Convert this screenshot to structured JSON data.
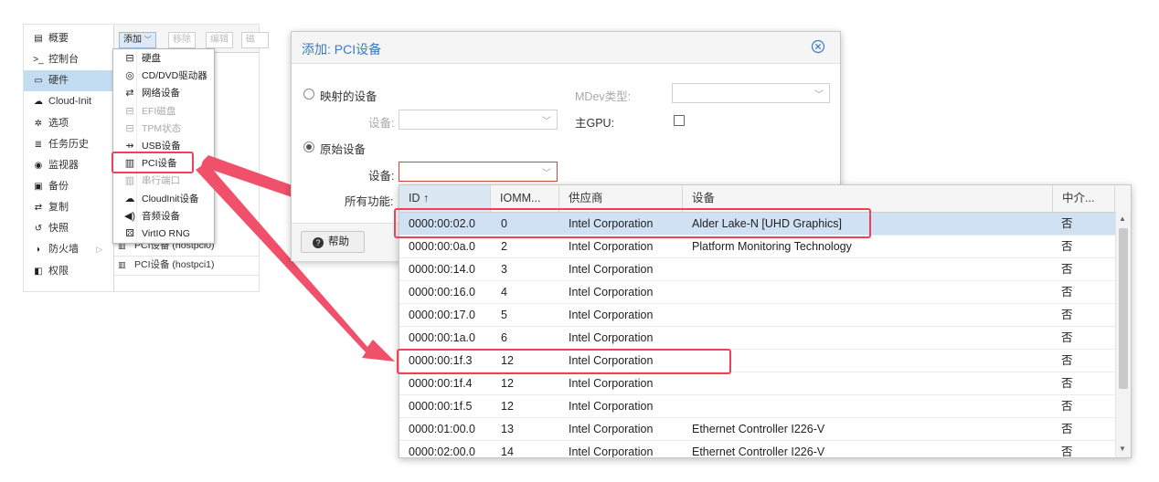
{
  "nav": {
    "items": [
      {
        "icon": "book-icon",
        "glyph": "▤",
        "label": "概要"
      },
      {
        "icon": "terminal-icon",
        "glyph": ">_",
        "label": "控制台"
      },
      {
        "icon": "monitor-icon",
        "glyph": "▭",
        "label": "硬件",
        "active": true
      },
      {
        "icon": "cloud-icon",
        "glyph": "☁",
        "label": "Cloud-Init"
      },
      {
        "icon": "gear-icon",
        "glyph": "✲",
        "label": "选项"
      },
      {
        "icon": "list-icon",
        "glyph": "≣",
        "label": "任务历史"
      },
      {
        "icon": "eye-icon",
        "glyph": "◉",
        "label": "监视器"
      },
      {
        "icon": "floppy-icon",
        "glyph": "▣",
        "label": "备份"
      },
      {
        "icon": "retweet-icon",
        "glyph": "⇄",
        "label": "复制"
      },
      {
        "icon": "history-icon",
        "glyph": "↺",
        "label": "快照"
      },
      {
        "icon": "shield-icon",
        "glyph": "◗",
        "label": "防火墙",
        "arrow": "▷"
      },
      {
        "icon": "unlock-icon",
        "glyph": "◧",
        "label": "权限"
      }
    ]
  },
  "toolbar": {
    "add_label": "添加",
    "remove_label": "移除",
    "edit_label": "编辑",
    "disk_action_label": "磁"
  },
  "hardware_rows": [
    {
      "label": "PCI设备 (hostpci0)"
    },
    {
      "label": "PCI设备 (hostpci1)"
    }
  ],
  "add_menu": {
    "items": [
      {
        "icon": "hdd-icon",
        "glyph": "⊟",
        "label": "硬盘",
        "disabled": false
      },
      {
        "icon": "optical-disc-icon",
        "glyph": "◎",
        "label": "CD/DVD驱动器",
        "disabled": false
      },
      {
        "icon": "network-icon",
        "glyph": "⇄",
        "label": "网络设备",
        "disabled": false
      },
      {
        "icon": "efi-disk-icon",
        "glyph": "⊟",
        "label": "EFI磁盘",
        "disabled": true
      },
      {
        "icon": "tpm-icon",
        "glyph": "⊟",
        "label": "TPM状态",
        "disabled": true
      },
      {
        "icon": "usb-icon",
        "glyph": "⇸",
        "label": "USB设备",
        "disabled": false
      },
      {
        "icon": "pci-card-icon",
        "glyph": "▥",
        "label": "PCI设备",
        "disabled": false
      },
      {
        "icon": "serial-port-icon",
        "glyph": "▥",
        "label": "串行端口",
        "disabled": true
      },
      {
        "icon": "cloud-icon",
        "glyph": "☁",
        "label": "CloudInit设备",
        "disabled": false
      },
      {
        "icon": "audio-icon",
        "glyph": "◀)",
        "label": "音频设备",
        "disabled": false
      },
      {
        "icon": "dice-icon",
        "glyph": "⚄",
        "label": "VirtIO RNG",
        "disabled": false
      }
    ]
  },
  "dialog": {
    "title": "添加: PCI设备",
    "mapped_device_label": "映射的设备",
    "device_label": "设备:",
    "mdev_type_label": "MDev类型:",
    "primary_gpu_label": "主GPU:",
    "raw_device_label": "原始设备",
    "raw_device_label_field": "设备:",
    "all_functions_label": "所有功能:",
    "help_label": "帮助"
  },
  "grid": {
    "columns": [
      "ID ↑",
      "IOMM...",
      "供应商",
      "设备",
      "中介..."
    ],
    "rows": [
      {
        "id": "0000:00:02.0",
        "iommu": "0",
        "vendor": "Intel Corporation",
        "device": "Alder Lake-N [UHD Graphics]",
        "mediated": "否",
        "selected": true
      },
      {
        "id": "0000:00:0a.0",
        "iommu": "2",
        "vendor": "Intel Corporation",
        "device": "Platform Monitoring Technology",
        "mediated": "否"
      },
      {
        "id": "0000:00:14.0",
        "iommu": "3",
        "vendor": "Intel Corporation",
        "device": "",
        "mediated": "否"
      },
      {
        "id": "0000:00:16.0",
        "iommu": "4",
        "vendor": "Intel Corporation",
        "device": "",
        "mediated": "否"
      },
      {
        "id": "0000:00:17.0",
        "iommu": "5",
        "vendor": "Intel Corporation",
        "device": "",
        "mediated": "否"
      },
      {
        "id": "0000:00:1a.0",
        "iommu": "6",
        "vendor": "Intel Corporation",
        "device": "",
        "mediated": "否"
      },
      {
        "id": "0000:00:1f.3",
        "iommu": "12",
        "vendor": "Intel Corporation",
        "device": "",
        "mediated": "否"
      },
      {
        "id": "0000:00:1f.4",
        "iommu": "12",
        "vendor": "Intel Corporation",
        "device": "",
        "mediated": "否"
      },
      {
        "id": "0000:00:1f.5",
        "iommu": "12",
        "vendor": "Intel Corporation",
        "device": "",
        "mediated": "否"
      },
      {
        "id": "0000:01:00.0",
        "iommu": "13",
        "vendor": "Intel Corporation",
        "device": "Ethernet Controller I226-V",
        "mediated": "否"
      },
      {
        "id": "0000:02:00.0",
        "iommu": "14",
        "vendor": "Intel Corporation",
        "device": "Ethernet Controller I226-V",
        "mediated": "否"
      }
    ]
  },
  "colors": {
    "accent_blue": "#3a7ac0",
    "highlight_red": "#f04058",
    "selection_blue": "#cfe1f3"
  }
}
